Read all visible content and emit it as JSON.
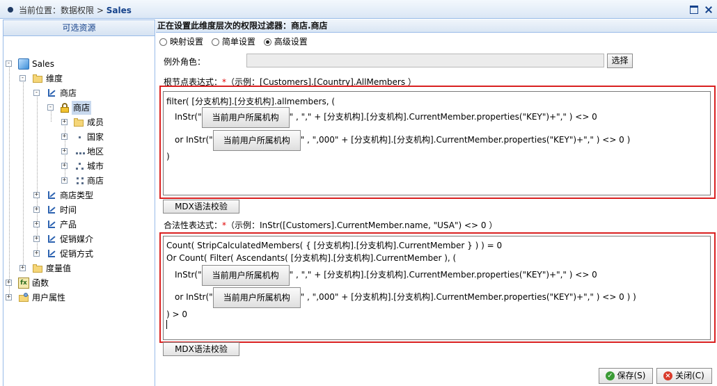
{
  "titlebar": {
    "location_label": "当前位置：",
    "crumb_parent": "数据权限",
    "separator": ">",
    "crumb_current": "Sales"
  },
  "left_panel": {
    "title": "可选资源",
    "tree": {
      "root": "Sales",
      "dimensions": "维度",
      "store_dim": "商店",
      "store_hier": "商店",
      "members": "成员",
      "level_country": "国家",
      "level_region": "地区",
      "level_city": "城市",
      "level_store": "商店",
      "store_type": "商店类型",
      "time": "时间",
      "product": "产品",
      "promo_media": "促销媒介",
      "promo_method": "促销方式",
      "measures": "度量值",
      "functions": "函数",
      "user_props": "用户属性"
    }
  },
  "main": {
    "header": "正在设置此维度层次的权限过滤器：商店.商店",
    "modes": {
      "mapping": "映射设置",
      "simple": "简单设置",
      "advanced": "高级设置",
      "selected": "高级设置"
    },
    "except_role_label": "例外角色：",
    "except_role_value": "",
    "select_button": "选择",
    "root_expr_label": "根节点表达式：",
    "required_mark": "*",
    "root_expr_example": "（示例：[Customers].[Country].AllMembers ）",
    "root_expr": {
      "line1": "filter( [分支机构].[分支机构].allmembers, (",
      "line2_pre": "InStr(\"",
      "line2_btn": "当前用户所属机构",
      "line2_post": "\" ,  \",\" + [分支机构].[分支机构].CurrentMember.properties(\"KEY\")+\",\" ) <> 0",
      "line3_pre": "or InStr(\"",
      "line3_btn": "当前用户所属机构",
      "line3_post": "\" ,  \",000\" + [分支机构].[分支机构].CurrentMember.properties(\"KEY\")+\",\" ) <> 0 )",
      "line4": ")"
    },
    "mdx_check_button": "MDX语法校验",
    "valid_expr_label": "合法性表达式：",
    "valid_expr_example": "（示例：InStr([Customers].CurrentMember.name, \"USA\") <> 0 ）",
    "valid_expr": {
      "line1": "Count( StripCalculatedMembers( { [分支机构].[分支机构].CurrentMember } ) ) = 0",
      "line2": "Or Count( Filter( Ascendants(  [分支机构].[分支机构].CurrentMember ),  (",
      "line3_pre": "InStr(\"",
      "line3_btn": "当前用户所属机构",
      "line3_post": "\" ,  \",\" + [分支机构].[分支机构].CurrentMember.properties(\"KEY\")+\",\" ) <> 0",
      "line4_pre": "or InStr(\"",
      "line4_btn": "当前用户所属机构",
      "line4_post": "\" ,  \",000\" + [分支机构].[分支机构].CurrentMember.properties(\"KEY\")+\",\" ) <> 0 ) )",
      "line5": ") > 0"
    },
    "mdx_check_button2": "MDX语法校验",
    "save_button": "保存(S)",
    "close_button": "关闭(C)"
  }
}
